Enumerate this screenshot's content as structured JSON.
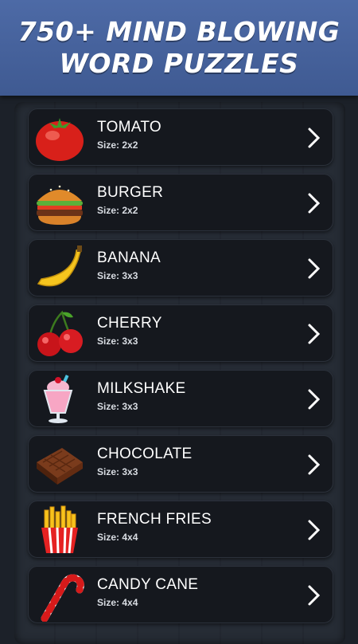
{
  "header": {
    "line1": "750+ MIND BLOWING",
    "line2": "WORD PUZZLES"
  },
  "puzzles": [
    {
      "name": "TOMATO",
      "size": "Size: 2x2",
      "icon": "tomato-icon"
    },
    {
      "name": "BURGER",
      "size": "Size: 2x2",
      "icon": "burger-icon"
    },
    {
      "name": "BANANA",
      "size": "Size: 3x3",
      "icon": "banana-icon"
    },
    {
      "name": "CHERRY",
      "size": "Size: 3x3",
      "icon": "cherry-icon"
    },
    {
      "name": "MILKSHAKE",
      "size": "Size: 3x3",
      "icon": "milkshake-icon"
    },
    {
      "name": "CHOCOLATE",
      "size": "Size: 3x3",
      "icon": "chocolate-icon"
    },
    {
      "name": "FRENCH FRIES",
      "size": "Size: 4x4",
      "icon": "french-fries-icon"
    },
    {
      "name": "CANDY CANE",
      "size": "Size: 4x4",
      "icon": "candy-cane-icon"
    }
  ],
  "colors": {
    "header_bg": "#4a66a0",
    "card_bg": "#15181e",
    "page_bg": "#1c2129"
  }
}
